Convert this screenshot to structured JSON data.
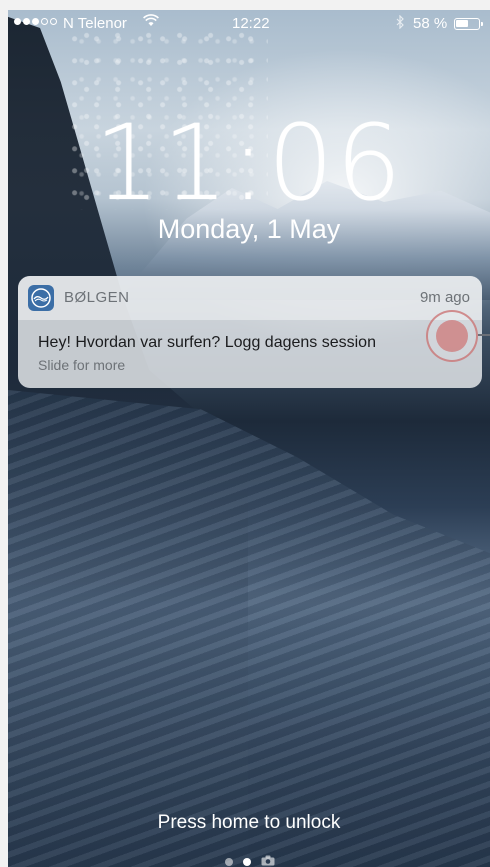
{
  "status_bar": {
    "carrier": "N Telenor",
    "time": "12:22",
    "battery_text": "58 %",
    "battery_level": 0.58
  },
  "lock_screen": {
    "time": "11:06",
    "date": "Monday, 1 May"
  },
  "notification": {
    "app_name": "BØLGEN",
    "time_ago": "9m ago",
    "message": "Hey! Hvordan var surfen? Logg dagens session",
    "hint": "Slide for more",
    "icon": "bolgen-app-icon"
  },
  "footer": {
    "unlock_text": "Press home to unlock",
    "pages": 3,
    "active_page": 1,
    "camera_icon": "camera-icon"
  }
}
